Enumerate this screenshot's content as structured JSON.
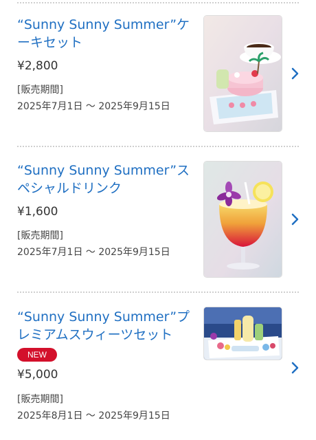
{
  "items": [
    {
      "title": "“Sunny Sunny Summer”ケーキセット",
      "badge": "",
      "price": "¥2,800",
      "period_label": "[販売期間]",
      "period": "2025年7月1日 〜 2025年9月15日",
      "image": "cake-set-photo"
    },
    {
      "title": "“Sunny Sunny Summer”スペシャルドリンク",
      "badge": "",
      "price": "¥1,600",
      "period_label": "[販売期間]",
      "period": "2025年7月1日 〜 2025年9月15日",
      "image": "special-drink-photo"
    },
    {
      "title": "“Sunny Sunny Summer”プレミアムスウィーツセット",
      "badge": "NEW",
      "price": "¥5,000",
      "period_label": "[販売期間]",
      "period": "2025年8月1日 〜 2025年9月15日",
      "image": "premium-sweets-set-photo"
    }
  ],
  "colors": {
    "title": "#1f6fc2",
    "badge": "#d3102b",
    "chevron": "#1f6fc2"
  },
  "icons": {
    "next": "chevron-right-icon"
  }
}
